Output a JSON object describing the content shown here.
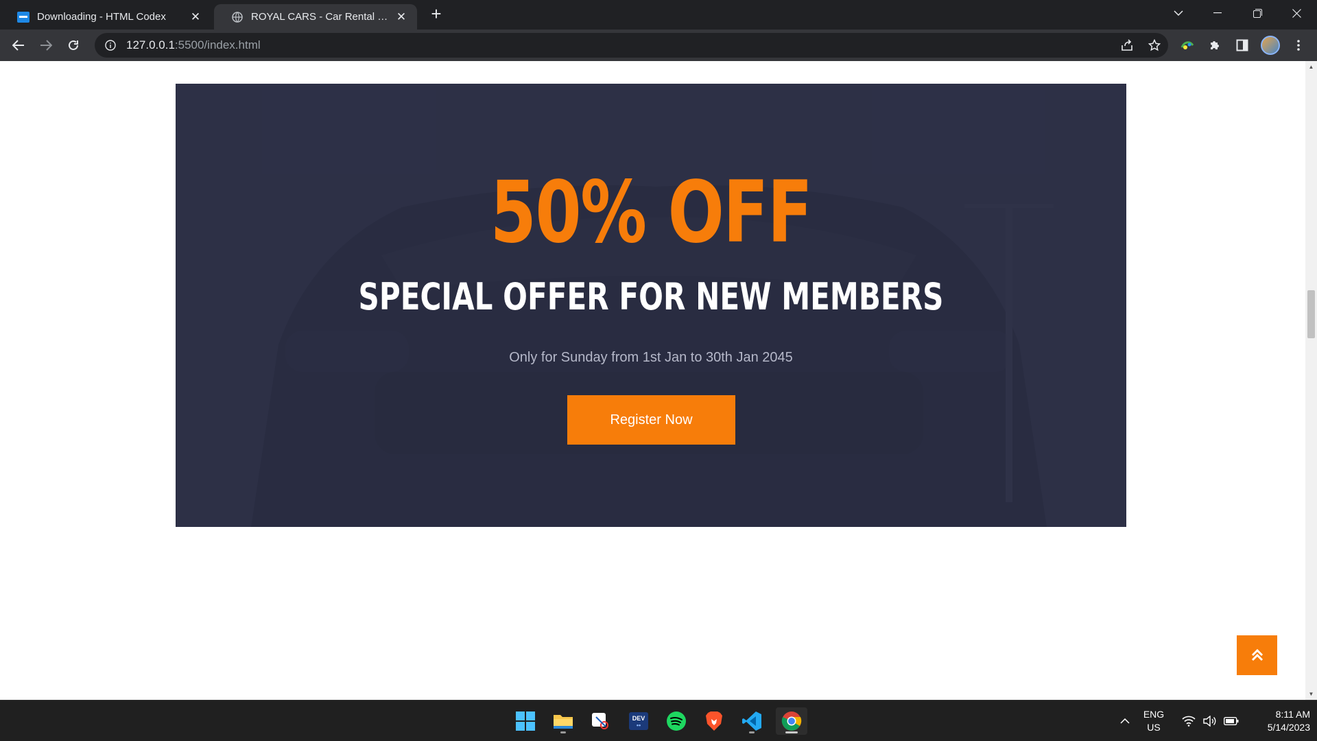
{
  "browser": {
    "tabs": [
      {
        "title": "Downloading - HTML Codex",
        "favicon": "htmlcodex-icon",
        "active": false
      },
      {
        "title": "ROYAL CARS - Car Rental HTML Template",
        "favicon": "globe-icon",
        "active": true
      }
    ],
    "url_host": "127.0.0.1",
    "url_rest": ":5500/index.html"
  },
  "banner": {
    "title": "50% OFF",
    "subtitle": "SPECIAL OFFER FOR NEW MEMBERS",
    "note": "Only for Sunday from 1st Jan to 30th Jan 2045",
    "button_label": "Register Now",
    "accent_color": "#F77D0A",
    "background_color": "#2B2E45"
  },
  "taskbar": {
    "apps": [
      "start-icon",
      "file-explorer-icon",
      "snipping-tool-icon",
      "devhome-icon",
      "spotify-icon",
      "brave-icon",
      "vscode-icon",
      "chrome-icon"
    ],
    "language": "ENG",
    "region": "US",
    "time": "8:11 AM",
    "date": "5/14/2023"
  }
}
